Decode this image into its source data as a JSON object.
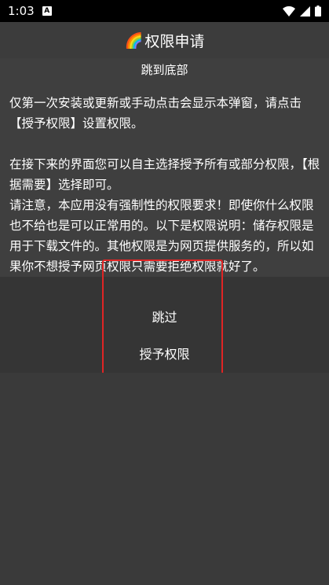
{
  "status_bar": {
    "time": "1:03",
    "notification_glyph": "A",
    "icons": [
      "wifi-icon",
      "signal-icon",
      "battery-icon"
    ]
  },
  "dialog": {
    "title_emoji": "🌈",
    "title": "权限申请",
    "jump_to_bottom": "跳到底部",
    "message": "仅第一次安装或更新或手动点击会显示本弹窗，请点击【授予权限】设置权限。\n\n在接下来的界面您可以自主选择授予所有或部分权限，【根据需要】选择即可。\n请注意，本应用没有强制性的权限要求！即使你什么权限也不给也是可以正常用的。以下是权限说明：储存权限是用于下载文件的。其他权限是为网页提供服务的，所以如果你不想授予网页权限只需要拒绝权限就好了。",
    "skip_button": "跳过",
    "grant_button": "授予权限"
  },
  "colors": {
    "highlight": "#e02424",
    "background": "#3a3a3a"
  }
}
